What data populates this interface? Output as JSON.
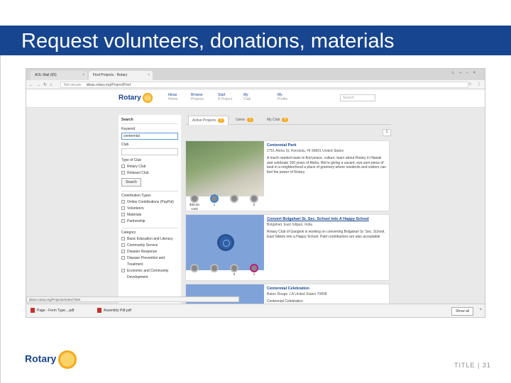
{
  "slide": {
    "title": "Request volunteers, donations, materials",
    "footer": "TITLE | 31",
    "logo": "Rotary"
  },
  "browser": {
    "tabs": [
      {
        "label": "AOL Mail (65)"
      },
      {
        "label": "Find Projects - Rotary"
      }
    ],
    "security_label": "Not secure",
    "url": "ideas.rotary.org/Project/Find",
    "status_url": "ideas.rotary.org/Projects/Index/7929"
  },
  "site": {
    "logo": "Rotary",
    "nav": [
      {
        "label": "Ideas",
        "sub": "Home"
      },
      {
        "label": "Browse",
        "sub": "Projects"
      },
      {
        "label": "Start",
        "sub": "A Project"
      },
      {
        "label": "My",
        "sub": "Club"
      },
      {
        "label": "My",
        "sub": "Profile"
      }
    ],
    "search_placeholder": "Search"
  },
  "sidebar": {
    "heading": "Search",
    "keyword_label": "Keyword",
    "keyword_value": "centennial",
    "club_label": "Club",
    "type_of_club_label": "Type of Club",
    "club_types": [
      "Rotary Club",
      "Rotaract Club"
    ],
    "search_button": "Search",
    "contribution_heading": "Contribution Types",
    "contribution_types": [
      "Online Contributions (PayPal)",
      "Volunteers",
      "Materials",
      "Partnership"
    ],
    "category_heading": "Category",
    "categories": [
      "Basic Education and Literacy",
      "Community Service",
      "Disaster Response",
      "Disease Prevention and",
      "Treatment",
      "Economic and Community",
      "Development"
    ]
  },
  "content": {
    "tabs": [
      {
        "label": "Active Projects",
        "count": "3"
      },
      {
        "label": "Users",
        "count": "1"
      },
      {
        "label": "My Club",
        "count": "0"
      }
    ],
    "page": "1",
    "cards": [
      {
        "title": "Centennial Park",
        "location": "2751 Aloha St, Honolulu, HI 96801 United States",
        "description": "A much needed oasis to find peace, culture. learn about Rotary in Hawaii and celebrate 100 years of Aloha. We're giving a vacant, eye-sore piece of land in a neighborhood a place of greenery where residents and visitors can feel the power of Rotary.",
        "stats": [
          "$36,00 USD",
          "1",
          "",
          "0"
        ]
      },
      {
        "title": "Convert Bolgahari Sr. Sec. School into A Happy School",
        "location": "Bolgahari, East Siliguri, India",
        "description": "Rotary Club of Gangtok is working on converting Bolgahari Sr. Sec. School, East Sikkim into a Happy School. Paid contributions are also acceptable",
        "stats": [
          "",
          "",
          "0",
          "1"
        ]
      },
      {
        "title": "Centennial Celebration",
        "location": "Baton Rouge, LA United States 70808",
        "description": "Centennial Celebration",
        "stats": []
      }
    ]
  },
  "downloads": {
    "items": [
      "Page - Form Type....pdf",
      "Assembly Pdf.pdf"
    ],
    "show_all": "Show all"
  }
}
